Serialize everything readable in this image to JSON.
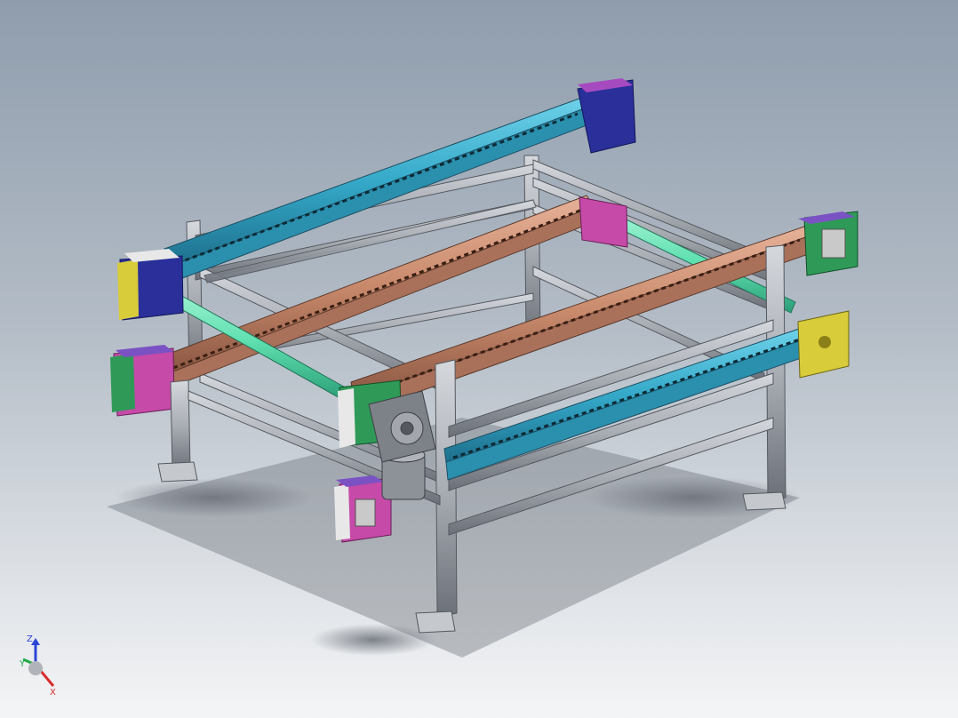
{
  "viewport": {
    "background_top": "#8f9dad",
    "background_bottom": "#f4f5f6"
  },
  "model": {
    "parts": [
      "aluminium-frame",
      "conveyor-rail-blue-back",
      "conveyor-rail-orange-middle",
      "conveyor-rail-orange-front",
      "conveyor-rail-blue-front",
      "drive-shaft-front",
      "drive-shaft-back",
      "gear-motor",
      "end-plates",
      "foot-plates"
    ],
    "colors": {
      "frame": "#a9adb4",
      "rail_blue": "#35a9c9",
      "rail_orange": "#c98a6c",
      "shaft": "#5fe0b0",
      "plate_navy": "#2a2f9a",
      "plate_magenta": "#c64aa8",
      "plate_green": "#2f9a57",
      "plate_yellow": "#d8cc3a",
      "motor": "#8d9198"
    }
  },
  "triad": {
    "z": "Z",
    "y": "Y",
    "x": "X",
    "colors": {
      "z": "#2b44d8",
      "y": "#22a84a",
      "x": "#d82b2b"
    }
  }
}
